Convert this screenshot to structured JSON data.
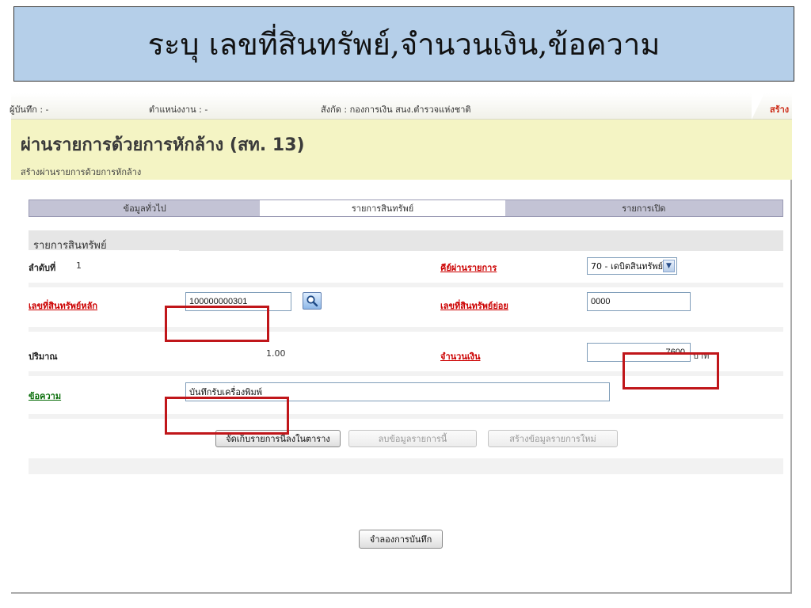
{
  "banner": {
    "text": "ระบุ เลขที่สินทรัพย์,จำนวนเงิน,ข้อความ"
  },
  "topbar": {
    "recorder": "ผู้บันทึก : -",
    "position": "ตำแหน่งงาน : -",
    "unit": "สังกัด : กองการเงิน สนง.ตำรวจแห่งชาติ",
    "create": "สร้าง"
  },
  "page": {
    "title": "ผ่านรายการด้วยการหักล้าง (สท. 13)",
    "subtitle": "สร้างผ่านรายการด้วยการหักล้าง"
  },
  "tabs": [
    {
      "label": "ข้อมูลทั่วไป",
      "state": "inactive"
    },
    {
      "label": "รายการสินทรัพย์",
      "state": "active"
    },
    {
      "label": "รายการเปิด",
      "state": "inactive"
    }
  ],
  "form": {
    "section_title": "รายการสินทรัพย์",
    "seq_label": "ลำดับที่",
    "seq_value": "1",
    "posting_key_label": "คีย์ผ่านรายการ",
    "posting_key_value": "70 - เดบิตสินทรัพย์",
    "main_asset_label": "เลขที่สินทรัพย์หลัก",
    "main_asset_value": "100000000301",
    "sub_asset_label": "เลขที่สินทรัพย์ย่อย",
    "sub_asset_value": "0000",
    "quantity_label": "ปริมาณ",
    "quantity_value": "1.00",
    "amount_label": "จำนวนเงิน",
    "amount_value": "7600",
    "currency": "บาท",
    "text_label": "ข้อความ",
    "text_value": "บันทึกรับเครื่องพิมพ์"
  },
  "buttons": {
    "store": "จัดเก็บรายการนี้ลงในตาราง",
    "delete": "ลบข้อมูลรายการนี้",
    "new": "สร้างข้อมูลรายการใหม่",
    "simulate": "จำลองการบันทึก"
  },
  "colors": {
    "banner_bg": "#b5cfe9",
    "title_bg": "#f4f4c4",
    "highlight": "#c0161a",
    "link_red": "#cc0000",
    "link_green": "#0a6e0a"
  },
  "icons": {
    "search": "magnifier-icon",
    "dropdown": "chevron-down-icon"
  }
}
